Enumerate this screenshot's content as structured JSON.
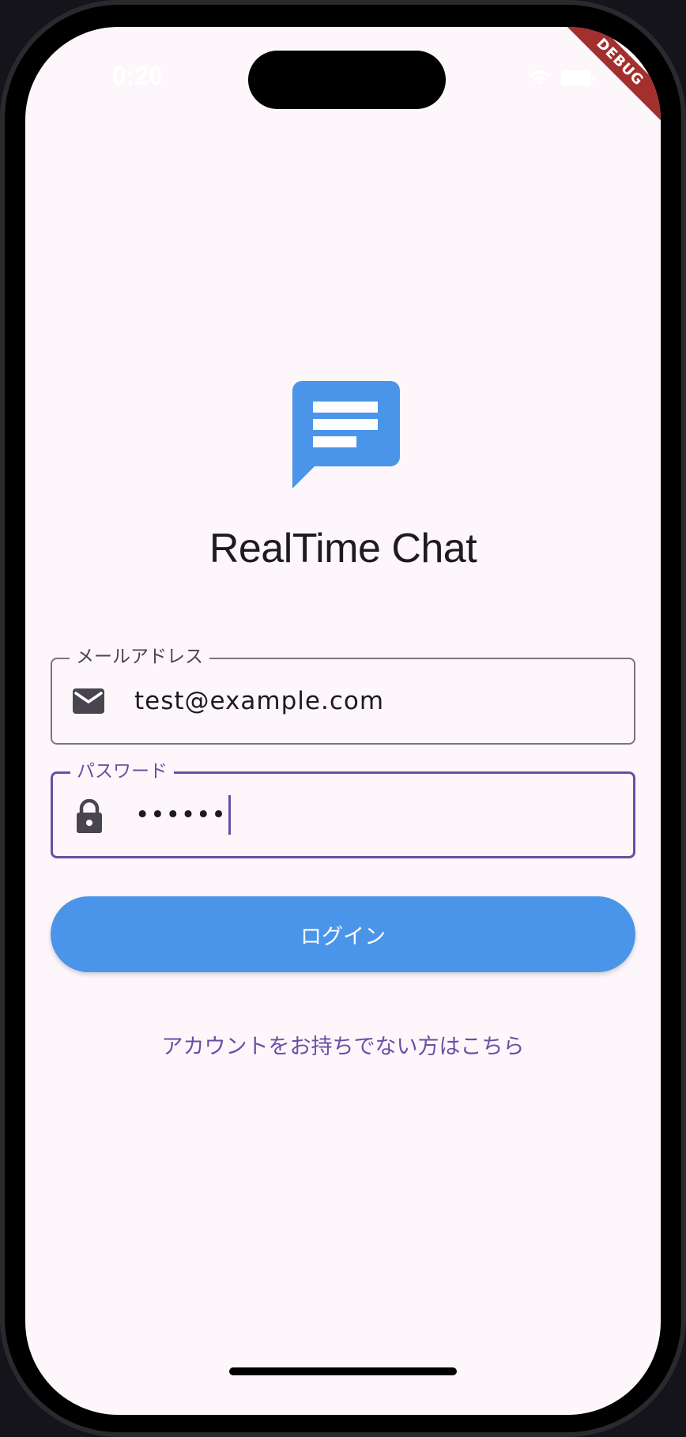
{
  "status_bar": {
    "time": "0:20",
    "wifi_icon": "wifi-icon",
    "battery_icon": "battery-icon"
  },
  "debug_banner": {
    "label": "DEBUG",
    "color": "#a3302e"
  },
  "logo": {
    "icon": "chat-bubble-icon",
    "color": "#4a95e9"
  },
  "app": {
    "title": "RealTime Chat"
  },
  "email_field": {
    "label": "メールアドレス",
    "value": "test@example.com",
    "icon": "mail-icon"
  },
  "password_field": {
    "label": "パスワード",
    "value": "••••••",
    "icon": "lock-icon",
    "focused": true
  },
  "login_button": {
    "label": "ログイン",
    "color": "#4a95e9"
  },
  "register_link": {
    "label": "アカウントをお持ちでない方はこちら",
    "color": "#6750a4"
  }
}
